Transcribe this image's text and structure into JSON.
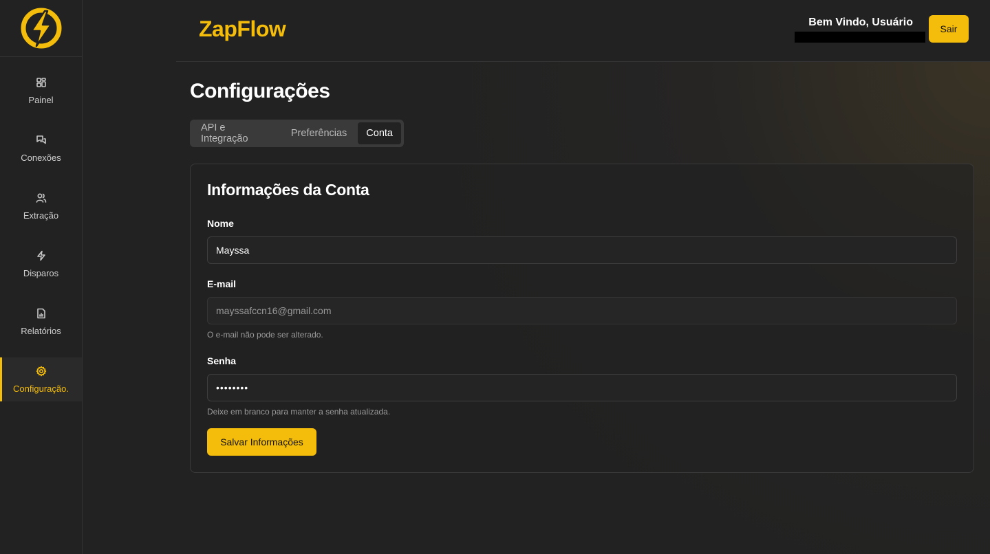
{
  "brand": {
    "name": "ZapFlow",
    "accent_color": "#f5bd0b"
  },
  "header": {
    "welcome": "Bem Vindo, Usuário",
    "logout_label": "Sair"
  },
  "sidebar": {
    "logo_icon": "lightning-bolt-logo",
    "items": [
      {
        "label": "Painel",
        "icon": "dashboard-icon",
        "active": false
      },
      {
        "label": "Conexões",
        "icon": "chat-bubbles-icon",
        "active": false
      },
      {
        "label": "Extração",
        "icon": "users-icon",
        "active": false
      },
      {
        "label": "Disparos",
        "icon": "lightning-icon",
        "active": false
      },
      {
        "label": "Relatórios",
        "icon": "report-file-icon",
        "active": false
      },
      {
        "label": "Configuração.",
        "icon": "gear-icon",
        "active": true
      }
    ]
  },
  "page": {
    "title": "Configurações",
    "tabs": [
      {
        "label": "API e Integração",
        "active": false
      },
      {
        "label": "Preferências",
        "active": false
      },
      {
        "label": "Conta",
        "active": true
      }
    ]
  },
  "account": {
    "title": "Informações da Conta",
    "name_label": "Nome",
    "name_value": "Mayssa",
    "email_label": "E-mail",
    "email_value": "mayssafccn16@gmail.com",
    "email_hint": "O e-mail não pode ser alterado.",
    "password_label": "Senha",
    "password_value": "••••••••",
    "password_hint": "Deixe em branco para manter a senha atualizada.",
    "save_label": "Salvar Informações"
  }
}
